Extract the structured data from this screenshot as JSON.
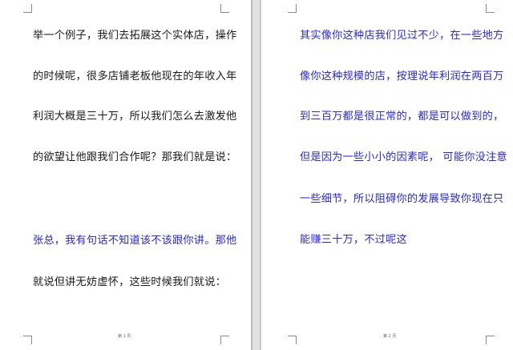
{
  "pages": [
    {
      "lines": [
        {
          "text": "举一个例子，我们去拓展这个实体店，操作",
          "color": "#1a1a1a"
        },
        {
          "text": "的时候呢，很多店铺老板他现在的年收入年",
          "color": "#1a1a1a"
        },
        {
          "text": "利润大概是三十万，所以我们怎么去激发他",
          "color": "#1a1a1a"
        },
        {
          "text": "的欲望让他跟我们合作呢？那我们就是说：",
          "color": "#1a1a1a"
        },
        {
          "text": "张总，我有句话不知道该不该跟你讲。那他",
          "color": "#2a2ad6"
        },
        {
          "text": "就说但讲无妨虚怀，这些时候我们就说：",
          "color": "#1a1a1a"
        }
      ],
      "footer": "第 1 页"
    },
    {
      "lines": [
        {
          "text": "其实像你这种店我们见过不少，在一些地方",
          "color": "#2a2ad6"
        },
        {
          "text": "像你这种规模的店，按理说年利润在两百万",
          "color": "#2a2ad6"
        },
        {
          "text": "到三百万都是很正常的，都是可以做到的，",
          "color": "#2a2ad6"
        },
        {
          "text": "但是因为一些小小的因素呢， 可能你没注意",
          "color": "#2a2ad6"
        },
        {
          "text": "一些细节，所以阻碍你的发展导致你现在只",
          "color": "#2a2ad6"
        },
        {
          "text": "能赚三十万，不过呢这",
          "color": "#2a2ad6"
        }
      ],
      "footer": "第 2 页"
    }
  ]
}
